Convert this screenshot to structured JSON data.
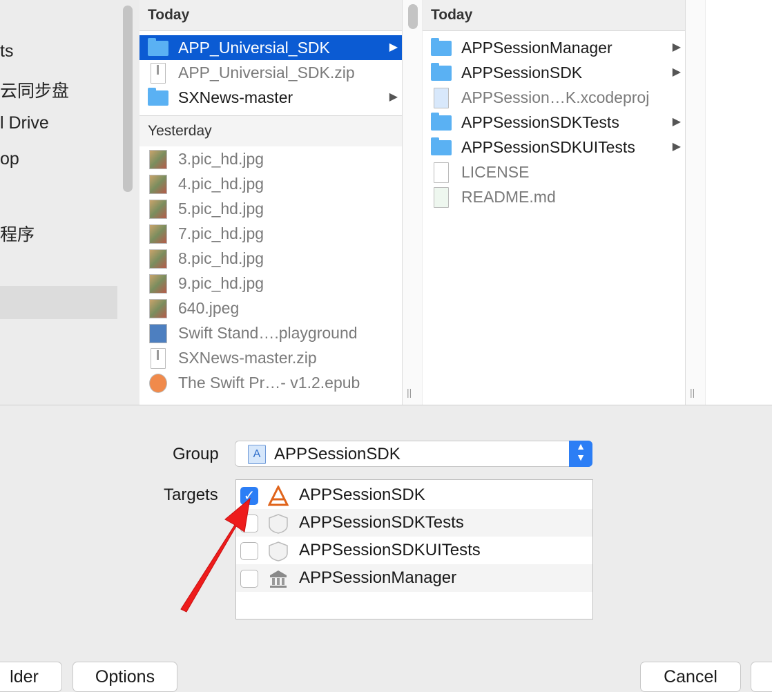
{
  "sidebar": {
    "items": [
      "ts",
      "云同步盘",
      "l Drive",
      "op",
      "程序"
    ]
  },
  "column1": {
    "header": "Today",
    "today_items": [
      {
        "label": "APP_Universial_SDK",
        "icon": "folder-icon",
        "arrow": "▶"
      },
      {
        "label": "APP_Universial_SDK.zip",
        "icon": "zip-file-icon",
        "arrow": ""
      },
      {
        "label": "SXNews-master",
        "icon": "folder-icon",
        "arrow": "▶"
      }
    ],
    "subheader": "Yesterday",
    "yesterday_items": [
      {
        "label": "3.pic_hd.jpg",
        "icon": "image-thumbnail-icon"
      },
      {
        "label": "4.pic_hd.jpg",
        "icon": "image-thumbnail-icon"
      },
      {
        "label": "5.pic_hd.jpg",
        "icon": "image-thumbnail-icon"
      },
      {
        "label": "7.pic_hd.jpg",
        "icon": "image-thumbnail-icon"
      },
      {
        "label": "8.pic_hd.jpg",
        "icon": "image-thumbnail-icon"
      },
      {
        "label": "9.pic_hd.jpg",
        "icon": "image-thumbnail-icon"
      },
      {
        "label": "640.jpeg",
        "icon": "image-thumbnail-icon"
      },
      {
        "label": "Swift Stand….playground",
        "icon": "playground-icon"
      },
      {
        "label": "SXNews-master.zip",
        "icon": "zip-file-icon"
      },
      {
        "label": "The Swift Pr…- v1.2.epub",
        "icon": "epub-icon"
      }
    ]
  },
  "column2": {
    "header": "Today",
    "items": [
      {
        "label": "APPSessionManager",
        "icon": "folder-icon",
        "arrow": "▶",
        "dim": false
      },
      {
        "label": "APPSessionSDK",
        "icon": "folder-icon",
        "arrow": "▶",
        "dim": false
      },
      {
        "label": "APPSession…K.xcodeproj",
        "icon": "xcodeproj-icon",
        "arrow": "",
        "dim": true
      },
      {
        "label": "APPSessionSDKTests",
        "icon": "folder-icon",
        "arrow": "▶",
        "dim": false
      },
      {
        "label": "APPSessionSDKUITests",
        "icon": "folder-icon",
        "arrow": "▶",
        "dim": false
      },
      {
        "label": "LICENSE",
        "icon": "document-icon",
        "arrow": "",
        "dim": true
      },
      {
        "label": "README.md",
        "icon": "markdown-icon",
        "arrow": "",
        "dim": true
      }
    ]
  },
  "form": {
    "group_label": "Group",
    "group_value": "APPSessionSDK",
    "targets_label": "Targets",
    "targets": [
      {
        "label": "APPSessionSDK",
        "checked": true,
        "icon": "app-target-icon"
      },
      {
        "label": "APPSessionSDKTests",
        "checked": false,
        "icon": "test-target-icon"
      },
      {
        "label": "APPSessionSDKUITests",
        "checked": false,
        "icon": "test-target-icon"
      },
      {
        "label": "APPSessionManager",
        "checked": false,
        "icon": "framework-target-icon"
      }
    ]
  },
  "buttons": {
    "new_folder": "lder",
    "options": "Options",
    "cancel": "Cancel"
  },
  "colors": {
    "selection": "#0b5bd3",
    "accent": "#2c7ef5",
    "folder": "#5ab1f3",
    "annotation_arrow": "#ee1c1c"
  }
}
